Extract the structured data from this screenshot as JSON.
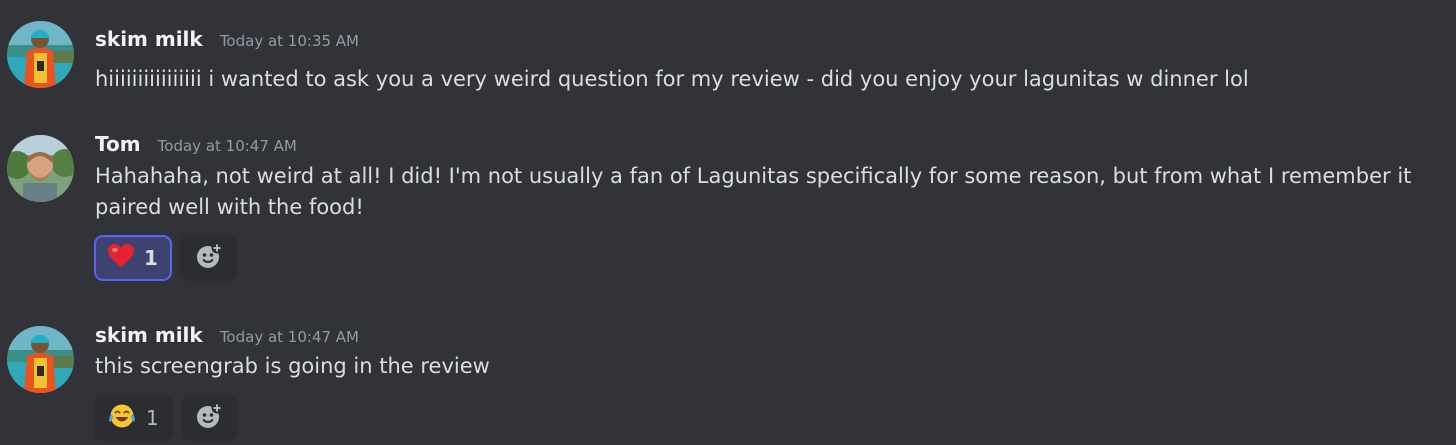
{
  "messages": [
    {
      "author": "skim milk",
      "timestamp": "Today at 10:35 AM",
      "text": "hiiiiiiiiiiiiiiii i wanted to ask you a very weird question for my review - did you enjoy your lagunitas w dinner lol"
    },
    {
      "author": "Tom",
      "timestamp": "Today at 10:47 AM",
      "text": "Hahahaha, not weird at all! I did! I'm not usually a fan of Lagunitas specifically for some reason, but from what I remember it paired well with the food!",
      "reaction": {
        "emoji": "heart-emoji",
        "count": "1",
        "active": true
      }
    },
    {
      "author": "skim milk",
      "timestamp": "Today at 10:47 AM",
      "text": "this screengrab is going in the review",
      "reaction": {
        "emoji": "joy-emoji",
        "count": "1",
        "active": false
      }
    }
  ],
  "colors": {
    "background": "#313338",
    "username": "#f2f3f5",
    "timestamp": "#949ba4",
    "text": "#dbdee1",
    "reaction_active_bg": "#3e4270",
    "reaction_active_border": "#5865f2",
    "reaction_bg": "#2b2d31"
  },
  "icons": {
    "add_reaction": "add-reaction-icon"
  }
}
